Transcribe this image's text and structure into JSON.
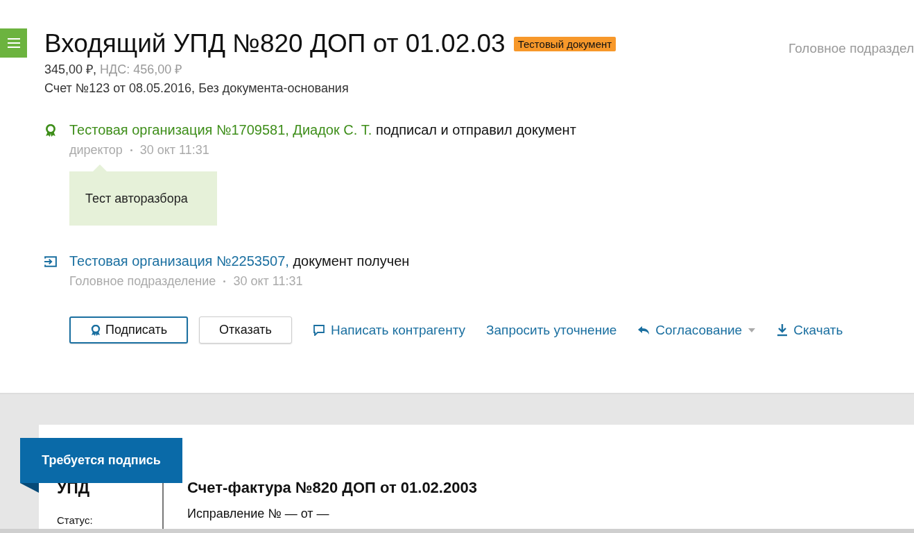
{
  "header": {
    "title": "Входящий УПД №820 ДОП от 01.02.03",
    "badge": "Тестовый документ",
    "department": "Головное подраздел",
    "amount": "345,00 ₽,",
    "vat": "НДС: 456,00 ₽",
    "basis": "Счет №123 от 08.05.2016, Без документа-основания"
  },
  "events": [
    {
      "kind": "signed",
      "org": "Тестовая организация №1709581, Диадок С. Т.",
      "action": "подписал и отправил документ",
      "meta": "директор",
      "time": "30 окт 11:31",
      "comment": "Тест авторазбора"
    },
    {
      "kind": "received",
      "org": "Тестовая организация №2253507,",
      "action": "документ получен",
      "meta": "Головное подразделение",
      "time": "30 окт 11:31"
    }
  ],
  "actions": [
    {
      "kind": "sign",
      "label": "Подписать"
    },
    {
      "kind": "plain",
      "label": "Отказать"
    },
    {
      "kind": "message",
      "label": "Написать контрагенту"
    },
    {
      "kind": "link",
      "label": "Запросить уточнение"
    },
    {
      "kind": "approval",
      "label": "Согласование"
    },
    {
      "kind": "download",
      "label": "Скачать"
    }
  ],
  "document": {
    "ribbon": "Требуется подпись",
    "type": "УПД",
    "status_label": "Статус:",
    "title": "Счет-фактура №820 ДОП от 01.02.2003",
    "correction": "Исправление № — от —"
  }
}
